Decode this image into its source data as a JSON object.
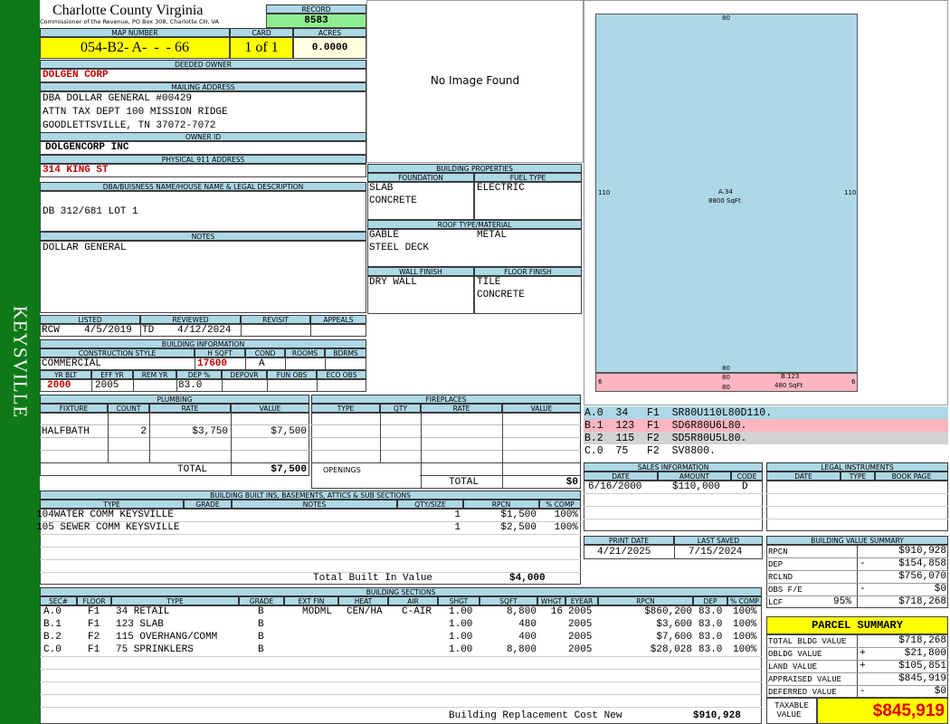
{
  "sidebar": {
    "district": "KEYSVILLE"
  },
  "header": {
    "county": "Charlotte County Virginia",
    "commissioner": "Commissioner of the Revenue, PO Box 308, Charlotte CH, VA",
    "record_label": "RECORD",
    "record": "8583",
    "map_label": "MAP NUMBER",
    "map_number": "054-B2- A-  -  - 66",
    "card_label": "CARD",
    "card": "1 of 1",
    "acres_label": "ACRES",
    "acres": "0.0000"
  },
  "owner": {
    "label": "DEEDED OWNER",
    "name": "DOLGEN CORP"
  },
  "mailing": {
    "label": "MAILING ADDRESS",
    "line1": "DBA DOLLAR GENERAL #00429",
    "line2": "ATTN TAX DEPT  100 MISSION RIDGE",
    "line3": "GOODLETTSVILLE, TN 37072-7072"
  },
  "owner_id": {
    "label": "OWNER ID",
    "value": "DOLGENCORP INC"
  },
  "physical": {
    "label": "PHYSICAL 911 ADDRESS",
    "value": "314 KING ST"
  },
  "legal": {
    "label": "DBA/BUISNESS NAME/HOUSE NAME & LEGAL DESCRIPTION",
    "value": "DB 312/681 LOT 1"
  },
  "notes": {
    "label": "NOTES",
    "value": "DOLLAR GENERAL"
  },
  "photo": {
    "text": "No Image Found"
  },
  "bprops": {
    "label": "BUILDING PROPERTIES",
    "foundation_label": "FOUNDATION",
    "fuel_label": "FUEL TYPE",
    "foundation1": "SLAB",
    "foundation2": "CONCRETE",
    "fuel": "ELECTRIC",
    "roof_label": "ROOF TYPE/MATERIAL",
    "roof1": "GABLE",
    "roof2": "STEEL DECK",
    "roof_mat": "METAL",
    "wall_label": "WALL FINISH",
    "floor_label": "FLOOR FINISH",
    "wall": "DRY WALL",
    "floor1": "TILE",
    "floor2": "CONCRETE"
  },
  "listed": {
    "listed_label": "LISTED",
    "reviewed_label": "REVIEWED",
    "revisit_label": "REVISIT",
    "appeals_label": "APPEALS",
    "lister": "RCW",
    "listed_date": "4/5/2019",
    "reviewer": "TD",
    "reviewed_date": "4/12/2024"
  },
  "binfo": {
    "label": "BUILDING INFORMATION",
    "style_label": "CONSTRUCTION STYLE",
    "hsqft_label": "H SQFT",
    "cond_label": "COND",
    "rooms_label": "ROOMS",
    "bdrms_label": "BDRMS",
    "style": "COMMERCIAL",
    "hsqft": "17600",
    "cond": "A",
    "yrblt_label": "YR BLT",
    "effyr_label": "EFF YR",
    "remyr_label": "REM YR",
    "dep_label": "DEP %",
    "depovr_label": "DEPOVR",
    "funobs_label": "FUN OBS",
    "ecoobs_label": "ECO OBS",
    "yrblt": "2000",
    "effyr": "2005",
    "dep": "83.0"
  },
  "plumbing": {
    "label": "PLUMBING",
    "cols": [
      "FIXTURE",
      "COUNT",
      "RATE",
      "VALUE"
    ],
    "rows": [
      {
        "fixture": "HALFBATH",
        "count": "2",
        "rate": "$3,750",
        "value": "$7,500"
      }
    ],
    "total_label": "TOTAL",
    "total": "$7,500"
  },
  "fireplaces": {
    "label": "FIREPLACES",
    "cols": [
      "TYPE",
      "QTY",
      "RATE",
      "VALUE"
    ],
    "openings_label": "OPENINGS",
    "total_label": "TOTAL",
    "total": "$0"
  },
  "builtins": {
    "label": "BUILDING BUILT INS, BASEMENTS, ATTICS & SUB SECTIONS",
    "cols": [
      "TYPE",
      "GRADE",
      "NOTES",
      "QTY/SIZE",
      "RPCN",
      "% COMP"
    ],
    "rows": [
      {
        "type": "104WATER COMM KEYSVILLE",
        "qty": "1",
        "rpcn": "$1,500",
        "comp": "100%"
      },
      {
        "type": "105 SEWER COMM KEYSVILLE",
        "qty": "1",
        "rpcn": "$2,500",
        "comp": "100%"
      }
    ],
    "total_label": "Total Built In Value",
    "total": "$4,000"
  },
  "sections": {
    "label": "BUILDING SECTIONS",
    "cols": [
      "SEC#",
      "FLOOR",
      "TYPE",
      "GRADE",
      "EXT FIN",
      "HEAT",
      "AIR",
      "SHGT",
      "SQFT",
      "WHGT",
      "EYEAR",
      "RPCN",
      "DEP",
      "% COMP"
    ],
    "rows": [
      {
        "sec": "A.0",
        "floor": "F1",
        "type": "34 RETAIL",
        "grade": "B",
        "ext": "MODML",
        "heat": "CEN/HA",
        "air": "C-AIR",
        "shgt": "1.00",
        "sqft": "8,800",
        "whgt": "16",
        "eyear": "2005",
        "rpcn": "$860,200",
        "dep": "83.0",
        "comp": "100%"
      },
      {
        "sec": "B.1",
        "floor": "F1",
        "type": "123 SLAB",
        "grade": "B",
        "ext": "",
        "heat": "",
        "air": "",
        "shgt": "1.00",
        "sqft": "480",
        "whgt": "",
        "eyear": "2005",
        "rpcn": "$3,600",
        "dep": "83.0",
        "comp": "100%"
      },
      {
        "sec": "B.2",
        "floor": "F2",
        "type": "115 OVERHANG/COMM",
        "grade": "B",
        "ext": "",
        "heat": "",
        "air": "",
        "shgt": "1.00",
        "sqft": "400",
        "whgt": "",
        "eyear": "2005",
        "rpcn": "$7,600",
        "dep": "83.0",
        "comp": "100%"
      },
      {
        "sec": "C.0",
        "floor": "F1",
        "type": "75 SPRINKLERS",
        "grade": "B",
        "ext": "",
        "heat": "",
        "air": "",
        "shgt": "1.00",
        "sqft": "8,800",
        "whgt": "",
        "eyear": "2005",
        "rpcn": "$28,028",
        "dep": "83.0",
        "comp": "100%"
      }
    ],
    "rcn_label": "Building Replacement Cost New",
    "rcn": "$910,928"
  },
  "sketch": {
    "top": "80",
    "left": "110",
    "right": "110",
    "bottom": "80",
    "main_label": "A.34",
    "main_area": "8800 SqFt",
    "strip_left": "6",
    "strip_right": "6",
    "strip_top": "80",
    "strip_bottom": "80",
    "strip_label": "B.123",
    "strip_area": "480 SqFt",
    "main_color": "#add8e6",
    "strip_color": "#ffb6c1"
  },
  "vectors": [
    {
      "text": "A.0  34   F1  SR80U110L80D110.",
      "color": "#add8e6"
    },
    {
      "text": "B.1  123  F1  SD6R80U6L80.",
      "color": "#ffb6c1"
    },
    {
      "text": "B.2  115  F2  SD5R80U5L80.",
      "color": "#d3d3d3"
    },
    {
      "text": "C.0  75   F2  SV8800.",
      "color": "#ffffff"
    }
  ],
  "sales": {
    "label": "SALES INFORMATION",
    "cols": [
      "DATE",
      "AMOUNT",
      "CODE"
    ],
    "rows": [
      {
        "date": "6/16/2000",
        "amount": "$110,000",
        "code": "D"
      }
    ]
  },
  "legal_inst": {
    "label": "LEGAL INSTRUMENTS",
    "cols": [
      "DATE",
      "TYPE",
      "BOOK PAGE"
    ]
  },
  "print": {
    "print_label": "PRINT DATE",
    "saved_label": "LAST SAVED",
    "print_date": "4/21/2025",
    "saved_date": "7/15/2024"
  },
  "bvs": {
    "label": "BUILDING VALUE SUMMARY",
    "rows": [
      {
        "label": "RPCN",
        "sign": "",
        "value": "$910,928"
      },
      {
        "label": "DEP",
        "sign": "-",
        "value": "$154,858"
      },
      {
        "label": "RCLND",
        "sign": "",
        "value": "$756,070"
      },
      {
        "label": "OBS F/E",
        "sign": "-",
        "value": "$0"
      },
      {
        "label": "LCF",
        "pct": "95%",
        "sign": "",
        "value": "$718,268"
      }
    ]
  },
  "parcel": {
    "label": "PARCEL SUMMARY",
    "rows": [
      {
        "label": "TOTAL BLDG VALUE",
        "sign": "",
        "value": "$718,268"
      },
      {
        "label": "OBLDG VALUE",
        "sign": "+",
        "value": "$21,800"
      },
      {
        "label": "LAND VALUE",
        "sign": "+",
        "value": "$105,851"
      },
      {
        "label": "APPRAISED VALUE",
        "sign": "",
        "value": "$845,919"
      },
      {
        "label": "DEFERRED VALUE",
        "sign": "-",
        "value": "$0"
      }
    ],
    "taxable_label1": "TAXABLE",
    "taxable_label2": "VALUE",
    "taxable": "$845,919"
  }
}
